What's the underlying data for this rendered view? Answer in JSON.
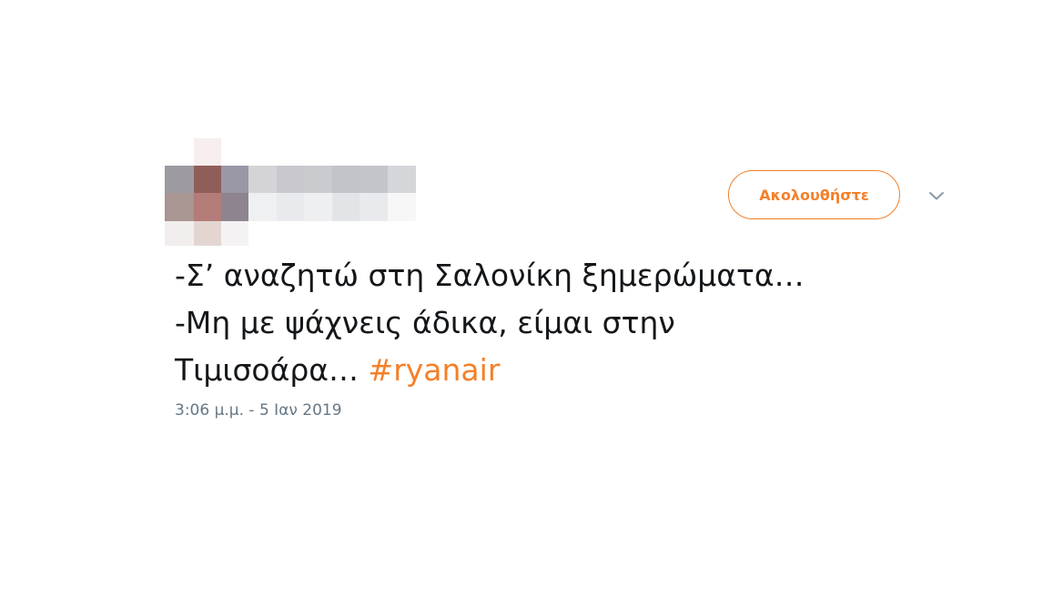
{
  "tweet": {
    "author": {
      "redacted": true
    },
    "follow_button": {
      "label": "Ακολουθήστε"
    },
    "menu_icon": "chevron-down-icon",
    "text_lines": [
      "-Σ’ αναζητώ στη Σαλονίκη ξημερώματα…",
      "-Μη με ψάχνεις άδικα, είμαι στην",
      "Τιμισοάρα…"
    ],
    "hashtag": "#ryanair",
    "timestamp": "3:06 μ.μ. - 5 Ιαν 2019"
  },
  "colors": {
    "accent": "#f4802a",
    "text": "#14171a",
    "muted": "#657786"
  }
}
